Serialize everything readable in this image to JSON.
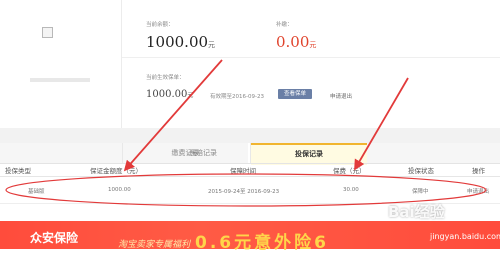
{
  "account": {
    "current_balance_label": "当前余额：",
    "current_balance_value": "1000.00",
    "current_balance_unit": "元",
    "subsidy_label": "补缴：",
    "subsidy_value": "0.00",
    "subsidy_unit": "元",
    "guarantee_label": "当前生效保单：",
    "guarantee_value": "1000.00",
    "guarantee_unit": "元",
    "valid_until": "有效期至2016-09-23",
    "badge": "查看保单",
    "exit_link": "申请退出"
  },
  "tabs": [
    {
      "label": "缴费记录"
    },
    {
      "label": "理赔记录"
    },
    {
      "label": "投保记录",
      "active": true
    }
  ],
  "table": {
    "columns": [
      "投保类型",
      "保证金额度（元）",
      "保障时间",
      "保费（元）",
      "投保状态",
      "操作"
    ],
    "rows": [
      {
        "type": "基础版",
        "amount": "1000.00",
        "period": "2015-09-24至 2016-09-23",
        "premium": "30.00",
        "status": "保障中",
        "action": "申请退出"
      }
    ]
  },
  "banner": {
    "logo": "众安保险",
    "slogan": "淘宝卖家专属福利",
    "big_text": "0.6元意外险6"
  },
  "watermark": {
    "logo": "Bai经验",
    "site": "jingyan.baidu.com"
  },
  "colors": {
    "accent_red": "#e0432c",
    "tab_active_border": "#f1b52f",
    "badge_bg": "#6a7fa6",
    "annotation_red": "#e23a3a"
  }
}
